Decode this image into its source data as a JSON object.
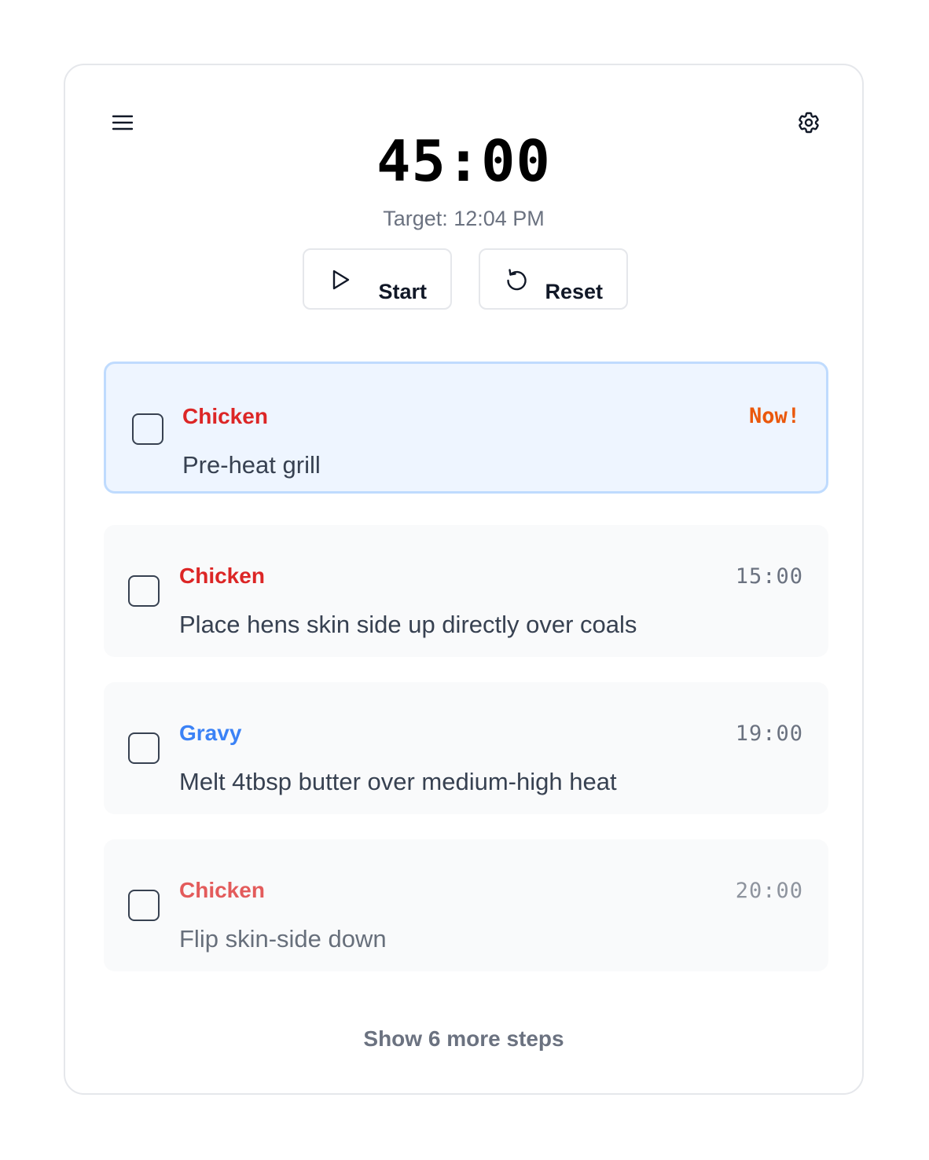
{
  "header": {
    "menu_icon": "hamburger-menu-icon",
    "settings_icon": "gear-icon"
  },
  "timer": {
    "display": "45:00",
    "target_text": "Target: 12:04 PM"
  },
  "controls": {
    "start_label": "Start",
    "start_icon": "play-icon",
    "reset_label": "Reset",
    "reset_icon": "reset-icon"
  },
  "steps": [
    {
      "category": "Chicken",
      "category_color": "#dc2626",
      "description": "Pre-heat grill",
      "time": "Now!",
      "time_color": "#ea580c",
      "active": true,
      "checked": false
    },
    {
      "category": "Chicken",
      "category_color": "#dc2626",
      "description": "Place hens skin side up directly over coals",
      "time": "15:00",
      "time_color": "#6b7280",
      "active": false,
      "checked": false
    },
    {
      "category": "Gravy",
      "category_color": "#3b82f6",
      "description": "Melt 4tbsp butter over medium-high heat",
      "time": "19:00",
      "time_color": "#6b7280",
      "active": false,
      "checked": false
    },
    {
      "category": "Chicken",
      "category_color": "#dc2626",
      "description": "Flip skin-side down",
      "time": "20:00",
      "time_color": "#6b7280",
      "active": false,
      "checked": false
    }
  ],
  "more_steps_label": "Show 6 more steps",
  "colors": {
    "active_bg": "#eef5ff",
    "active_border": "#bfdbfe",
    "step_bg": "#f9fafb",
    "border": "#e5e7eb"
  }
}
